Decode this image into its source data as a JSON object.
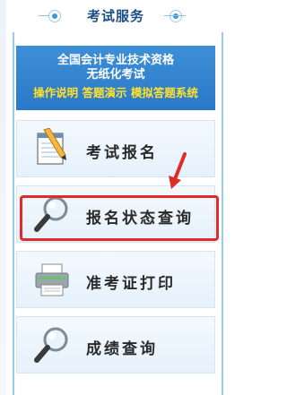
{
  "header": {
    "title": "考试服务"
  },
  "banner": {
    "line1": "全国会计专业技术资格",
    "line2": "无纸化考试",
    "line3": "操作说明 答题演示 模拟答题系统"
  },
  "menu": [
    {
      "label": "考试报名",
      "icon": "notepad-pencil-icon"
    },
    {
      "label": "报名状态查询",
      "icon": "magnifier-icon"
    },
    {
      "label": "准考证打印",
      "icon": "printer-icon"
    },
    {
      "label": "成绩查询",
      "icon": "magnifier-icon"
    }
  ],
  "colors": {
    "accent": "#3f97d8",
    "banner": "#2a78c8",
    "banner_highlight": "#ffe12b",
    "annotation": "#e02b2b"
  }
}
